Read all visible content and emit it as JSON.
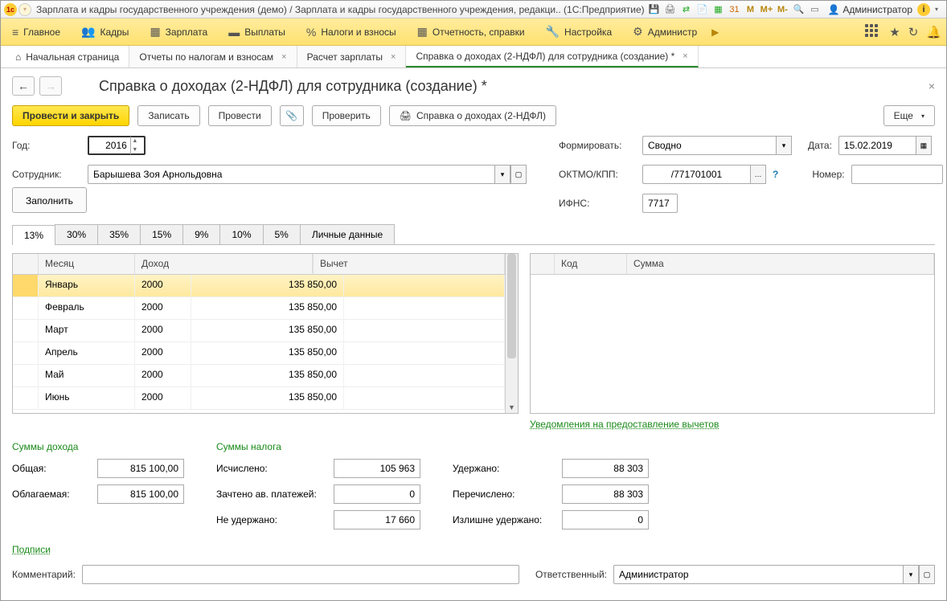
{
  "titlebar": {
    "title": "Зарплата и кадры государственного учреждения (демо) / Зарплата и кадры государственного учреждения, редакци.. (1С:Предприятие)",
    "user": "Администратор",
    "memory_icons": [
      "M",
      "M+",
      "M-"
    ]
  },
  "mainmenu": {
    "items": [
      {
        "icon": "≡",
        "label": "Главное"
      },
      {
        "icon": "👥",
        "label": "Кадры"
      },
      {
        "icon": "▦",
        "label": "Зарплата"
      },
      {
        "icon": "💰",
        "label": "Выплаты"
      },
      {
        "icon": "%",
        "label": "Налоги и взносы"
      },
      {
        "icon": "▦",
        "label": "Отчетность, справки"
      },
      {
        "icon": "🔧",
        "label": "Настройка"
      },
      {
        "icon": "⚙",
        "label": "Администр"
      }
    ]
  },
  "tabs": [
    {
      "label": "Начальная страница",
      "home": true
    },
    {
      "label": "Отчеты по налогам и взносам",
      "closable": true
    },
    {
      "label": "Расчет зарплаты",
      "closable": true
    },
    {
      "label": "Справка о доходах (2-НДФЛ) для сотрудника (создание) *",
      "closable": true,
      "active": true
    }
  ],
  "page": {
    "title": "Справка о доходах (2-НДФЛ) для сотрудника (создание) *",
    "toolbar": {
      "post_close": "Провести и закрыть",
      "save": "Записать",
      "post": "Провести",
      "check": "Проверить",
      "print": "Справка о доходах (2-НДФЛ)",
      "more": "Еще"
    },
    "fields": {
      "year_label": "Год:",
      "year": "2016",
      "employee_label": "Сотрудник:",
      "employee": "Барышева Зоя Арнольдовна",
      "form_label": "Формировать:",
      "form_value": "Сводно",
      "date_label": "Дата:",
      "date": "15.02.2019",
      "oktmo_label": "ОКТМО/КПП:",
      "oktmo": "/771701001",
      "number_label": "Номер:",
      "number": "",
      "ifns_label": "ИФНС:",
      "ifns": "7717",
      "fill": "Заполнить"
    },
    "subtabs": [
      "13%",
      "30%",
      "35%",
      "15%",
      "9%",
      "10%",
      "5%",
      "Личные данные"
    ],
    "income_table": {
      "headers": {
        "month": "Месяц",
        "income": "Доход",
        "deduction": "Вычет"
      },
      "rows": [
        {
          "month": "Январь",
          "code": "2000",
          "amount": "135 850,00",
          "selected": true
        },
        {
          "month": "Февраль",
          "code": "2000",
          "amount": "135 850,00"
        },
        {
          "month": "Март",
          "code": "2000",
          "amount": "135 850,00"
        },
        {
          "month": "Апрель",
          "code": "2000",
          "amount": "135 850,00"
        },
        {
          "month": "Май",
          "code": "2000",
          "amount": "135 850,00"
        },
        {
          "month": "Июнь",
          "code": "2000",
          "amount": "135 850,00"
        }
      ]
    },
    "deduction_table": {
      "headers": {
        "code": "Код",
        "sum": "Сумма"
      }
    },
    "notif_link": "Уведомления на предоставление вычетов",
    "sums": {
      "income_head": "Суммы дохода",
      "tax_head": "Суммы налога",
      "total_label": "Общая:",
      "total": "815 100,00",
      "taxable_label": "Облагаемая:",
      "taxable": "815 100,00",
      "calc_label": "Исчислено:",
      "calc": "105 963",
      "advance_label": "Зачтено ав. платежей:",
      "advance": "0",
      "notwithheld_label": "Не удержано:",
      "notwithheld": "17 660",
      "withheld_label": "Удержано:",
      "withheld": "88 303",
      "transferred_label": "Перечислено:",
      "transferred": "88 303",
      "excess_label": "Излишне удержано:",
      "excess": "0"
    },
    "sign_link": "Подписи",
    "comment_label": "Комментарий:",
    "responsible_label": "Ответственный:",
    "responsible": "Администратор"
  }
}
